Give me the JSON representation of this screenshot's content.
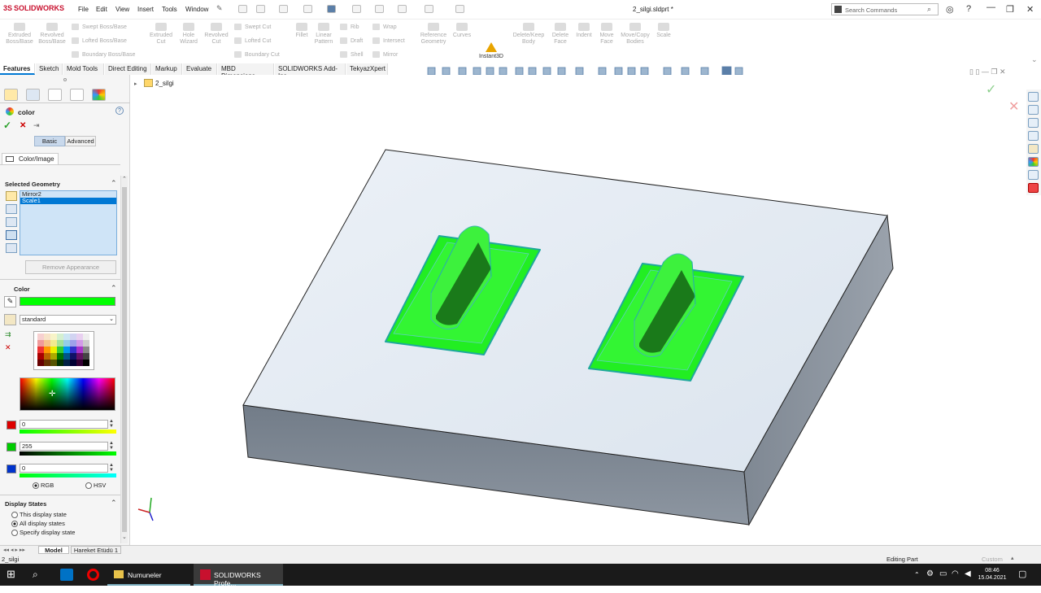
{
  "app": {
    "brand": "SOLIDWORKS",
    "doc_title": "2_silgi.sldprt *"
  },
  "menu": [
    "File",
    "Edit",
    "View",
    "Insert",
    "Tools",
    "Window"
  ],
  "search": {
    "placeholder": "Search Commands"
  },
  "ribbon": {
    "extruded_boss": "Extruded Boss/Base",
    "revolved_boss": "Revolved Boss/Base",
    "swept_boss": "Swept Boss/Base",
    "lofted_boss": "Lofted Boss/Base",
    "boundary_boss": "Boundary Boss/Base",
    "extruded_cut": "Extruded Cut",
    "hole_wizard": "Hole Wizard",
    "revolved_cut": "Revolved Cut",
    "swept_cut": "Swept Cut",
    "lofted_cut": "Lofted Cut",
    "boundary_cut": "Boundary Cut",
    "fillet": "Fillet",
    "linear_pattern": "Linear Pattern",
    "rib": "Rib",
    "draft": "Draft",
    "shell": "Shell",
    "wrap": "Wrap",
    "intersect": "Intersect",
    "mirror": "Mirror",
    "reference_geometry": "Reference Geometry",
    "curves": "Curves",
    "instant3d": "Instant3D",
    "delete_keep_body": "Delete/Keep Body",
    "delete_face": "Delete Face",
    "indent": "Indent",
    "move_face": "Move Face",
    "move_copy_bodies": "Move/Copy Bodies",
    "scale": "Scale"
  },
  "tabs": [
    "Features",
    "Sketch",
    "Mold Tools",
    "Direct Editing",
    "Markup",
    "Evaluate",
    "MBD Dimensions",
    "SOLIDWORKS Add-Ins",
    "TekyazXpert"
  ],
  "panel": {
    "title": "color",
    "mode_basic": "Basic",
    "mode_advanced": "Advanced",
    "color_image_tab": "Color/Image",
    "selected_geometry": "Selected Geometry",
    "selection_items": [
      "Mirror2",
      "Scale1"
    ],
    "remove_appearance": "Remove Appearance",
    "color_header": "Color",
    "swatch_color": "#00ff00",
    "palette": "standard",
    "r_value": "0",
    "g_value": "255",
    "b_value": "0",
    "rgb_label": "RGB",
    "hsv_label": "HSV",
    "display_states_header": "Display States",
    "ds_this": "This display state",
    "ds_all": "All display states",
    "ds_specify": "Specify display state"
  },
  "tree": {
    "root": "2_silgi"
  },
  "bottom_tabs": {
    "model": "Model",
    "motion": "Hareket Etüdü 1"
  },
  "status": {
    "left": "2_silgi",
    "mode": "Editing Part",
    "units": "Custom"
  },
  "taskbar": {
    "folder": "Numuneler",
    "solidworks": "SOLIDWORKS Profe...",
    "time": "08:46",
    "date": "15.04.2021"
  },
  "colors": {
    "highlight": "#00ff00",
    "selection": "#0078d4"
  }
}
